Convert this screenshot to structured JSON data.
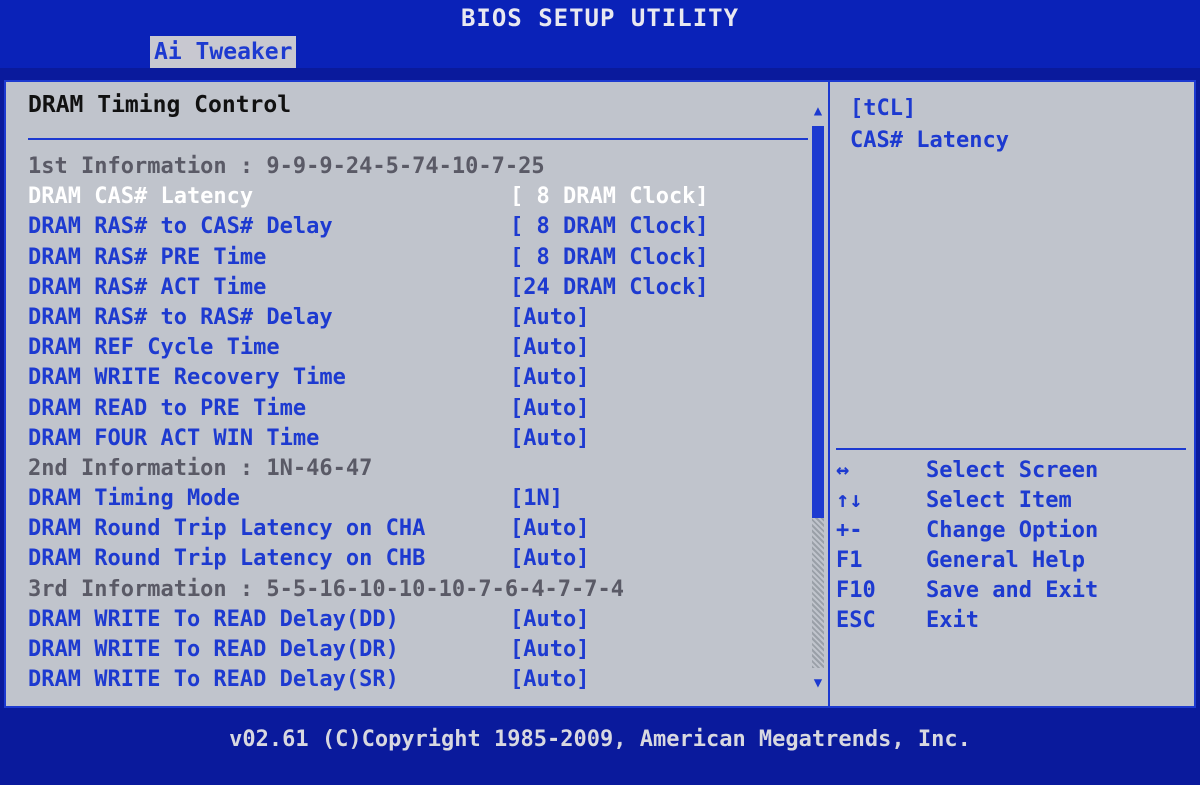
{
  "window": {
    "title": "BIOS SETUP UTILITY"
  },
  "menu": {
    "active_tab": "Ai Tweaker"
  },
  "main": {
    "section_title": "DRAM Timing Control",
    "rows": [
      {
        "type": "info",
        "text": "1st Information : 9-9-9-24-5-74-10-7-25"
      },
      {
        "type": "setting",
        "label": "DRAM CAS# Latency",
        "value": "[ 8 DRAM Clock]",
        "selected": true
      },
      {
        "type": "setting",
        "label": "DRAM RAS# to CAS# Delay",
        "value": "[ 8 DRAM Clock]"
      },
      {
        "type": "setting",
        "label": "DRAM RAS# PRE Time",
        "value": "[ 8 DRAM Clock]"
      },
      {
        "type": "setting",
        "label": "DRAM RAS# ACT Time",
        "value": "[24 DRAM Clock]"
      },
      {
        "type": "setting",
        "label": "DRAM RAS# to RAS# Delay",
        "value": "[Auto]"
      },
      {
        "type": "setting",
        "label": "DRAM REF Cycle Time",
        "value": "[Auto]"
      },
      {
        "type": "setting",
        "label": "DRAM WRITE Recovery Time",
        "value": "[Auto]"
      },
      {
        "type": "setting",
        "label": "DRAM READ to PRE Time",
        "value": "[Auto]"
      },
      {
        "type": "setting",
        "label": "DRAM FOUR ACT WIN Time",
        "value": "[Auto]"
      },
      {
        "type": "info",
        "text": "2nd Information : 1N-46-47"
      },
      {
        "type": "setting",
        "label": "DRAM Timing Mode",
        "value": "[1N]"
      },
      {
        "type": "setting",
        "label": "DRAM Round Trip Latency on CHA",
        "value": "[Auto]"
      },
      {
        "type": "setting",
        "label": "DRAM Round Trip Latency on CHB",
        "value": "[Auto]"
      },
      {
        "type": "info",
        "text": "3rd Information : 5-5-16-10-10-10-7-6-4-7-7-4"
      },
      {
        "type": "setting",
        "label": "DRAM WRITE To READ Delay(DD)",
        "value": "[Auto]"
      },
      {
        "type": "setting",
        "label": "DRAM WRITE To READ Delay(DR)",
        "value": "[Auto]"
      },
      {
        "type": "setting",
        "label": "DRAM WRITE To READ Delay(SR)",
        "value": "[Auto]"
      }
    ]
  },
  "scrollbar": {
    "up_icon": "▲",
    "down_icon": "▼",
    "position": 0.0
  },
  "help": {
    "item_code": "[tCL]",
    "item_desc": "CAS# Latency",
    "keys": [
      {
        "key": "↔",
        "action": "Select Screen"
      },
      {
        "key": "↑↓",
        "action": "Select Item"
      },
      {
        "key": "+-",
        "action": "Change Option"
      },
      {
        "key": "F1",
        "action": "General Help"
      },
      {
        "key": "F10",
        "action": "Save and Exit"
      },
      {
        "key": "ESC",
        "action": "Exit"
      }
    ]
  },
  "footer": {
    "text": "v02.61 (C)Copyright 1985-2009, American Megatrends, Inc."
  },
  "colors": {
    "background": "#0a1a9c",
    "panel": "#c0c4cc",
    "accent": "#1d3ad0",
    "selected_text": "#ffffff",
    "info_text": "#5a5a66"
  }
}
